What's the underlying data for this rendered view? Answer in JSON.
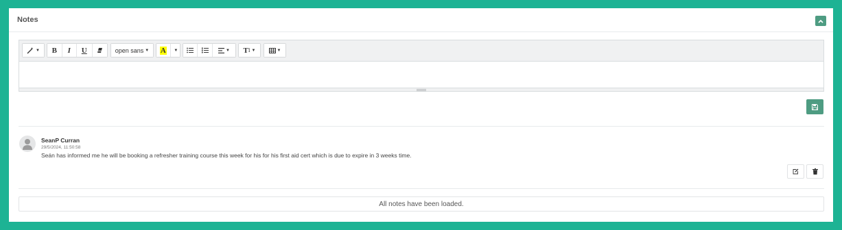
{
  "panel": {
    "title": "Notes"
  },
  "toolbar": {
    "style_icon": "magic-wand-icon",
    "bold_label": "B",
    "italic_label": "I",
    "underline_label": "U",
    "eraser_icon": "eraser-icon",
    "font_name": "open sans",
    "color_label": "A",
    "highlight_color": "#ffff00",
    "ul_icon": "unordered-list-icon",
    "ol_icon": "ordered-list-icon",
    "align_icon": "align-icon",
    "text_size_label": "T",
    "text_size_sup": "I",
    "table_icon": "table-icon"
  },
  "note": {
    "author": "SeanP Curran",
    "date": "29/5/2024, 11:50:58",
    "text": "Seán has informed me he will be booking a refresher training course this week for his for his first aid cert which is due to expire in 3 weeks time."
  },
  "footer": {
    "loaded_message": "All notes have been loaded."
  },
  "colors": {
    "accent": "#4e9c82",
    "page_background": "#1db394"
  }
}
